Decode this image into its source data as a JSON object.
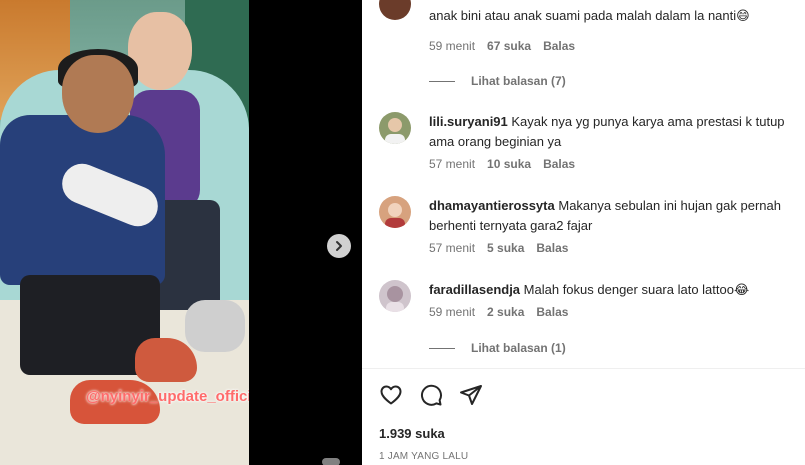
{
  "media": {
    "watermark": "@nyinyir_update_official",
    "next_icon": "chevron-right-icon"
  },
  "partial_comment": {
    "text": "anak bini atau anak suami pada malah dalam la nanti",
    "emoji": "😄",
    "time": "59 menit",
    "likes": "67 suka",
    "reply": "Balas",
    "view_replies": "Lihat balasan (7)"
  },
  "comments": [
    {
      "user": "lili.suryani91",
      "text": "Kayak nya yg punya karya ama prestasi k tutup ama orang beginian ya",
      "time": "57 menit",
      "likes": "10 suka",
      "reply": "Balas",
      "avatar_color": "#7a8a5a"
    },
    {
      "user": "dhamayantierossyta",
      "text": "Makanya sebulan ini hujan gak pernah berhenti ternyata gara2 fajar",
      "time": "57 menit",
      "likes": "5 suka",
      "reply": "Balas",
      "avatar_color": "#c98a6a"
    },
    {
      "user": "faradillasendja",
      "text": "Malah fokus denger suara lato lattoo😂",
      "time": "59 menit",
      "likes": "2 suka",
      "reply": "Balas",
      "view_replies": "Lihat balasan (1)",
      "avatar_color": "#b9a7b4"
    }
  ],
  "actions": {
    "icons": [
      "heart-icon",
      "comment-icon",
      "share-icon"
    ],
    "likes": "1.939 suka",
    "time": "1 JAM YANG LALU"
  }
}
